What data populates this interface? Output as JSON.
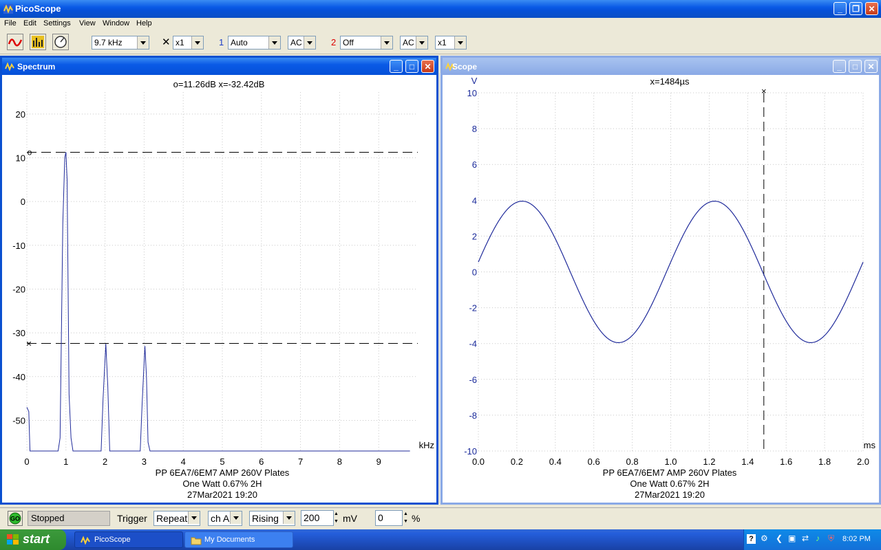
{
  "app": {
    "title": "PicoScope"
  },
  "menu": [
    "File",
    "Edit",
    "Settings",
    "View",
    "Window",
    "Help"
  ],
  "toolbar": {
    "timebase": "9.7 kHz",
    "mult_symbol": "✕",
    "mult": "x1",
    "ch1_label": "1",
    "ch1_range": "Auto",
    "ch1_coupling": "AC",
    "ch2_label": "2",
    "ch2_range": "Off",
    "ch2_coupling": "AC",
    "ch2_mult": "x1"
  },
  "spectrum": {
    "title": "Spectrum",
    "readout": "o=11.26dB  x=-32.42dB",
    "xunit": "kHz",
    "caption": [
      "PP 6EA7/6EM7 AMP 260V Plates",
      "One Watt 0.67% 2H",
      "27Mar2021  19:20"
    ],
    "cursor_o": "o",
    "cursor_x": "×"
  },
  "scope": {
    "title": "Scope",
    "readout": "x=1484µs",
    "yunit": "V",
    "xunit": "ms",
    "caption": [
      "PP 6EA7/6EM7 AMP 260V Plates",
      "One Watt 0.67% 2H",
      "27Mar2021  19:20"
    ],
    "cursor_x": "×"
  },
  "chart_data": [
    {
      "type": "line",
      "name": "Spectrum",
      "x_ticks": [
        "0",
        "1",
        "2",
        "3",
        "4",
        "5",
        "6",
        "7",
        "8",
        "9"
      ],
      "y_ticks": [
        "20",
        "10",
        "0",
        "-10",
        "-20",
        "-30",
        "-40",
        "-50"
      ],
      "xlim": [
        0,
        10
      ],
      "ylim": [
        -57,
        25
      ],
      "xlabel": "kHz",
      "cursors": {
        "o_db": 11.26,
        "x_db": -32.42
      },
      "x": [
        0,
        0.05,
        0.08,
        0.8,
        0.85,
        0.92,
        0.97,
        1.0,
        1.03,
        1.08,
        1.13,
        1.18,
        1.9,
        1.95,
        2.02,
        2.07,
        2.12,
        2.9,
        2.95,
        3.02,
        3.06,
        3.1,
        3.15,
        9.8
      ],
      "y": [
        -47,
        -48,
        -57,
        -57,
        -54,
        -5,
        10,
        11.3,
        5,
        -44,
        -54,
        -57,
        -57,
        -45,
        -32.5,
        -42,
        -57,
        -57,
        -46,
        -33,
        -40,
        -55,
        -57,
        -57
      ],
      "grid": true
    },
    {
      "type": "line",
      "name": "Scope",
      "x_ticks": [
        "0.0",
        "0.2",
        "0.4",
        "0.6",
        "0.8",
        "1.0",
        "1.2",
        "1.4",
        "1.6",
        "1.8",
        "2.0"
      ],
      "y_ticks": [
        "10",
        "8",
        "6",
        "4",
        "2",
        "0",
        "-2",
        "-4",
        "-6",
        "-8",
        "-10"
      ],
      "xlim": [
        0,
        2.0
      ],
      "ylim": [
        -10,
        10
      ],
      "xlabel": "ms",
      "ylabel": "V",
      "amplitude_v": 3.95,
      "frequency_khz": 1.0,
      "phase_deg": 8,
      "cursor_ms": 1.484,
      "grid": true
    }
  ],
  "status": {
    "state": "Stopped",
    "trigger_label": "Trigger",
    "trigger_mode": "Repeat",
    "trigger_channel": "ch A",
    "trigger_edge": "Rising",
    "trigger_level": "200",
    "trigger_level_unit": "mV",
    "pretrigger": "0",
    "pretrigger_unit": "%"
  },
  "taskbar": {
    "start": "start",
    "tasks": [
      "PicoScope",
      "My Documents"
    ],
    "clock": "8:02 PM"
  }
}
